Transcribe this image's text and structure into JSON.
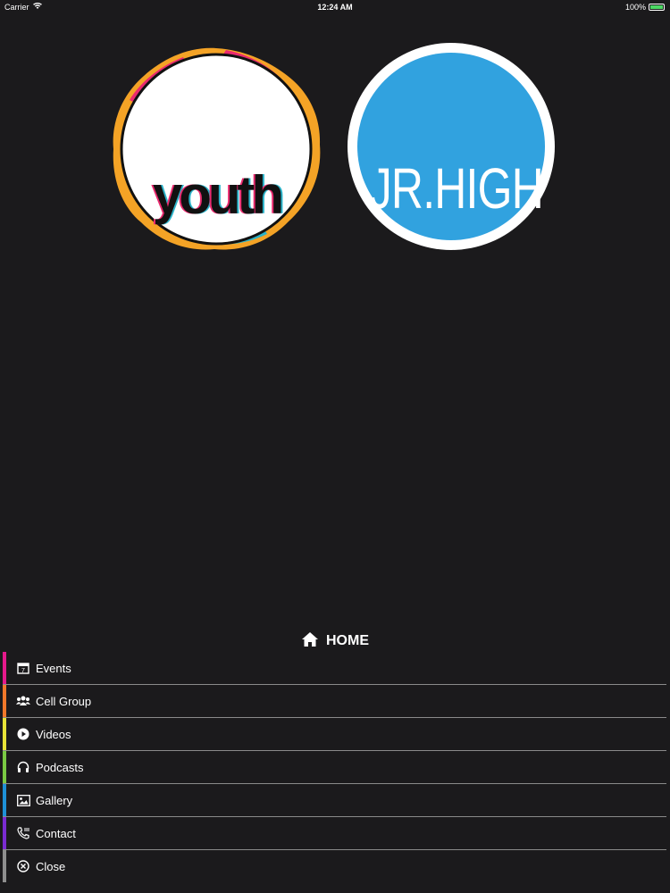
{
  "status_bar": {
    "carrier": "Carrier",
    "time": "12:24 AM",
    "battery": "100%"
  },
  "logos": {
    "youth": "youth",
    "jrhigh": "JR.HIGH"
  },
  "menu": {
    "title": "HOME",
    "items": [
      {
        "label": "Events",
        "icon": "calendar-icon",
        "color": "#e6198c"
      },
      {
        "label": "Cell Group",
        "icon": "group-icon",
        "color": "#f2782a"
      },
      {
        "label": "Videos",
        "icon": "play-icon",
        "color": "#e8e337"
      },
      {
        "label": "Podcasts",
        "icon": "headphones-icon",
        "color": "#7ac943"
      },
      {
        "label": "Gallery",
        "icon": "image-icon",
        "color": "#1e90d6"
      },
      {
        "label": "Contact",
        "icon": "phone-icon",
        "color": "#7a2bd1"
      },
      {
        "label": "Close",
        "icon": "close-icon",
        "color": "#8e8e8e"
      }
    ]
  },
  "colors": {
    "background": "#1b1a1c",
    "jrhigh_blue": "#31a2df"
  }
}
